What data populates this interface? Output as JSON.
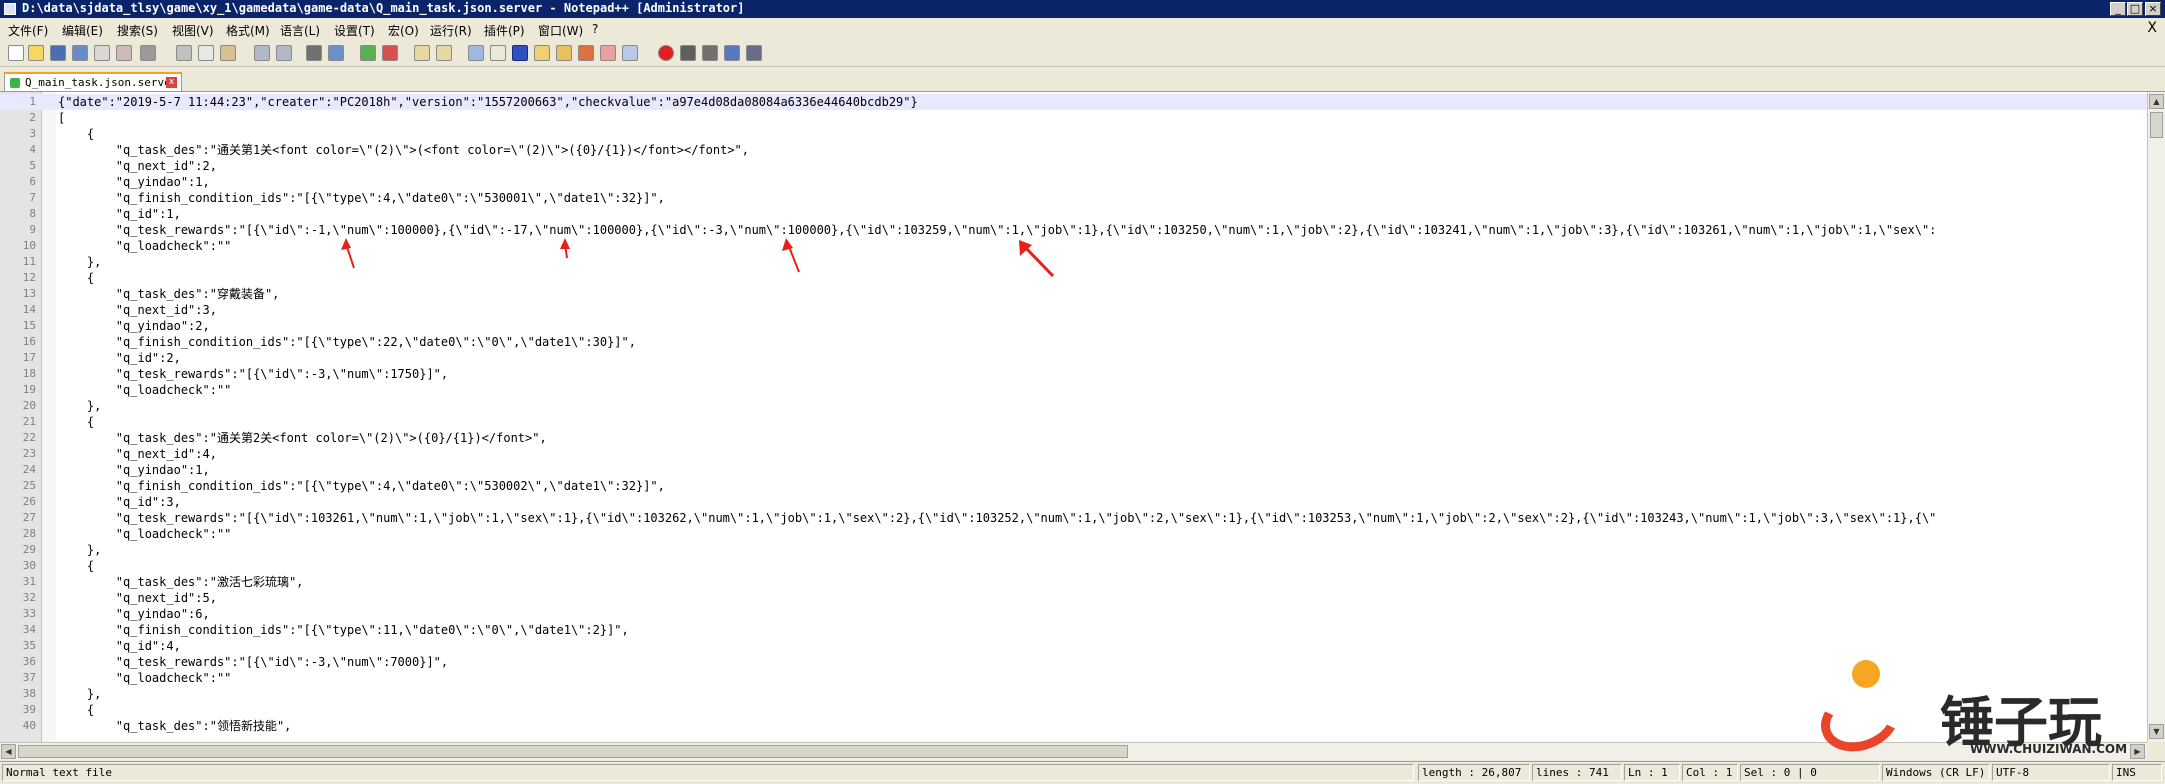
{
  "window": {
    "title": "D:\\data\\sjdata_tlsy\\game\\xy_1\\gamedata\\game-data\\Q_main_task.json.server - Notepad++ [Administrator]"
  },
  "menu": {
    "items": [
      "文件(F)",
      "编辑(E)",
      "搜索(S)",
      "视图(V)",
      "格式(M)",
      "语言(L)",
      "设置(T)",
      "宏(O)",
      "运行(R)",
      "插件(P)",
      "窗口(W)",
      "?"
    ],
    "close_glyph": "X"
  },
  "toolbar": {
    "buttons": [
      "new-file-icon",
      "open-file-icon",
      "save-icon",
      "save-all-icon",
      "close-icon",
      "close-all-icon",
      "print-icon",
      "cut-icon",
      "copy-icon",
      "paste-icon",
      "undo-icon",
      "redo-icon",
      "find-icon",
      "replace-icon",
      "zoom-in-icon",
      "zoom-out-icon",
      "sync-vertical-icon",
      "sync-horizontal-icon",
      "word-wrap-icon",
      "show-all-chars-icon",
      "indent-guide-icon",
      "user-language-icon",
      "doc-map-icon",
      "function-list-icon",
      "folder-workspace-icon",
      "monitor-icon",
      "record-macro-icon",
      "stop-macro-icon",
      "play-macro-icon",
      "run-macro-multiple-icon",
      "save-macro-icon"
    ]
  },
  "tab": {
    "label": "Q_main_task.json.server",
    "close_glyph": "x"
  },
  "editor": {
    "lines": [
      {
        "n": "1",
        "text": "{\"date\":\"2019-5-7 11:44:23\",\"creater\":\"PC2018h\",\"version\":\"1557200663\",\"checkvalue\":\"a97e4d08da08084a6336e44640bcdb29\"}"
      },
      {
        "n": "2",
        "text": "["
      },
      {
        "n": "3",
        "text": "    {"
      },
      {
        "n": "4",
        "text": "        \"q_task_des\":\"通关第1关<font color=\\\"(2)\\\">(<font color=\\\"(2)\\\">({0}/{1})</font></font>\","
      },
      {
        "n": "5",
        "text": "        \"q_next_id\":2,"
      },
      {
        "n": "6",
        "text": "        \"q_yindao\":1,"
      },
      {
        "n": "7",
        "text": "        \"q_finish_condition_ids\":\"[{\\\"type\\\":4,\\\"date0\\\":\\\"530001\\\",\\\"date1\\\":32}]\","
      },
      {
        "n": "8",
        "text": "        \"q_id\":1,"
      },
      {
        "n": "9",
        "text": "        \"q_tesk_rewards\":\"[{\\\"id\\\":-1,\\\"num\\\":100000},{\\\"id\\\":-17,\\\"num\\\":100000},{\\\"id\\\":-3,\\\"num\\\":100000},{\\\"id\\\":103259,\\\"num\\\":1,\\\"job\\\":1},{\\\"id\\\":103250,\\\"num\\\":1,\\\"job\\\":2},{\\\"id\\\":103241,\\\"num\\\":1,\\\"job\\\":3},{\\\"id\\\":103261,\\\"num\\\":1,\\\"job\\\":1,\\\"sex\\\":"
      },
      {
        "n": "10",
        "text": "        \"q_loadcheck\":\"\""
      },
      {
        "n": "11",
        "text": "    },"
      },
      {
        "n": "12",
        "text": "    {"
      },
      {
        "n": "13",
        "text": "        \"q_task_des\":\"穿戴装备\","
      },
      {
        "n": "14",
        "text": "        \"q_next_id\":3,"
      },
      {
        "n": "15",
        "text": "        \"q_yindao\":2,"
      },
      {
        "n": "16",
        "text": "        \"q_finish_condition_ids\":\"[{\\\"type\\\":22,\\\"date0\\\":\\\"0\\\",\\\"date1\\\":30}]\","
      },
      {
        "n": "17",
        "text": "        \"q_id\":2,"
      },
      {
        "n": "18",
        "text": "        \"q_tesk_rewards\":\"[{\\\"id\\\":-3,\\\"num\\\":1750}]\","
      },
      {
        "n": "19",
        "text": "        \"q_loadcheck\":\"\""
      },
      {
        "n": "20",
        "text": "    },"
      },
      {
        "n": "21",
        "text": "    {"
      },
      {
        "n": "22",
        "text": "        \"q_task_des\":\"通关第2关<font color=\\\"(2)\\\">({0}/{1})</font>\","
      },
      {
        "n": "23",
        "text": "        \"q_next_id\":4,"
      },
      {
        "n": "24",
        "text": "        \"q_yindao\":1,"
      },
      {
        "n": "25",
        "text": "        \"q_finish_condition_ids\":\"[{\\\"type\\\":4,\\\"date0\\\":\\\"530002\\\",\\\"date1\\\":32}]\","
      },
      {
        "n": "26",
        "text": "        \"q_id\":3,"
      },
      {
        "n": "27",
        "text": "        \"q_tesk_rewards\":\"[{\\\"id\\\":103261,\\\"num\\\":1,\\\"job\\\":1,\\\"sex\\\":1},{\\\"id\\\":103262,\\\"num\\\":1,\\\"job\\\":1,\\\"sex\\\":2},{\\\"id\\\":103252,\\\"num\\\":1,\\\"job\\\":2,\\\"sex\\\":1},{\\\"id\\\":103253,\\\"num\\\":1,\\\"job\\\":2,\\\"sex\\\":2},{\\\"id\\\":103243,\\\"num\\\":1,\\\"job\\\":3,\\\"sex\\\":1},{\\\""
      },
      {
        "n": "28",
        "text": "        \"q_loadcheck\":\"\""
      },
      {
        "n": "29",
        "text": "    },"
      },
      {
        "n": "30",
        "text": "    {"
      },
      {
        "n": "31",
        "text": "        \"q_task_des\":\"激活七彩琉璃\","
      },
      {
        "n": "32",
        "text": "        \"q_next_id\":5,"
      },
      {
        "n": "33",
        "text": "        \"q_yindao\":6,"
      },
      {
        "n": "34",
        "text": "        \"q_finish_condition_ids\":\"[{\\\"type\\\":11,\\\"date0\\\":\\\"0\\\",\\\"date1\\\":2}]\","
      },
      {
        "n": "35",
        "text": "        \"q_id\":4,"
      },
      {
        "n": "36",
        "text": "        \"q_tesk_rewards\":\"[{\\\"id\\\":-3,\\\"num\\\":7000}]\","
      },
      {
        "n": "37",
        "text": "        \"q_loadcheck\":\"\""
      },
      {
        "n": "38",
        "text": "    },"
      },
      {
        "n": "39",
        "text": "    {"
      },
      {
        "n": "40",
        "text": "        \"q_task_des\":\"领悟新技能\","
      }
    ],
    "colors": {
      "text": "#000000",
      "line_number": "#808080",
      "current_line": "#e8e8ff",
      "annotation_arrow": "#e8201a"
    }
  },
  "status": {
    "file_type": "Normal text file",
    "length": "length : 26,807",
    "lines": "lines : 741",
    "ln": "Ln : 1",
    "col": "Col : 1",
    "sel": "Sel : 0 | 0",
    "eol": "Windows (CR LF)",
    "encoding": "UTF-8",
    "ins": "INS"
  },
  "watermark": {
    "brand": "锤子玩",
    "site": "WWW.CHUIZIWAN.COM"
  }
}
